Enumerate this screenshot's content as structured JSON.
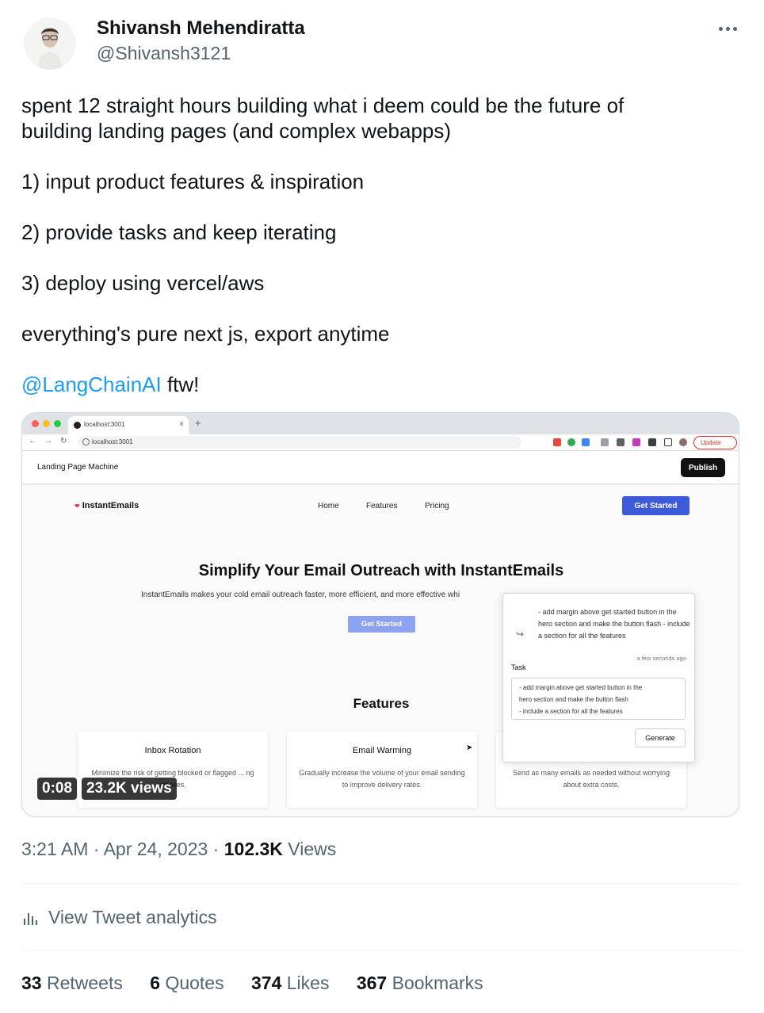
{
  "author": {
    "name": "Shivansh Mehendiratta",
    "handle": "@Shivansh3121"
  },
  "tweet": {
    "line1": "spent 12 straight hours building what i deem could be the future of",
    "line2": "building landing pages (and complex webapps)",
    "step1": "1) input product features & inspiration",
    "step2": "2) provide tasks and keep iterating",
    "step3": "3) deploy using vercel/aws",
    "closing": "everything's pure next js, export anytime",
    "mention": "@LangChainAI",
    "suffix": " ftw!"
  },
  "media": {
    "browser": {
      "tab_title": "localhost:3001",
      "new_tab": "+",
      "url": "localhost:3001",
      "update_label": "Update"
    },
    "app": {
      "title": "Landing Page Machine",
      "publish_label": "Publish"
    },
    "site": {
      "brand": "InstantEmails",
      "nav": [
        "Home",
        "Features",
        "Pricing"
      ],
      "cta": "Get Started",
      "hero_title": "Simplify Your Email Outreach with InstantEmails",
      "hero_subtitle": "InstantEmails makes your cold email outreach faster, more efficient, and more effective whi",
      "hero_cta": "Get Started",
      "features_title": "Features",
      "features": [
        {
          "title": "Inbox Rotation",
          "desc": "Minimize the risk of getting blocked or flagged ... ng inboxes."
        },
        {
          "title": "Email Warming",
          "desc": "Gradually increase the volume of your email sending to improve delivery rates."
        },
        {
          "title": "",
          "desc": "Send as many emails as needed without worrying about extra costs."
        }
      ]
    },
    "task_panel": {
      "history": "- add margin above get started button in the hero section and make the button flash - include a section for all the features",
      "time": "a few seconds ago",
      "label": "Task",
      "task_line1": "- add margin above get started button in the",
      "task_line2": "hero section and make the button flash",
      "task_line3": "- include a section for all the features",
      "generate_label": "Generate"
    },
    "video": {
      "duration": "0:08",
      "views": "23.2K views"
    }
  },
  "meta": {
    "time": "3:21 AM",
    "date": "Apr 24, 2023",
    "views_count": "102.3K",
    "views_label": "Views"
  },
  "analytics_label": "View Tweet analytics",
  "stats": {
    "retweets_count": "33",
    "retweets_label": "Retweets",
    "quotes_count": "6",
    "quotes_label": "Quotes",
    "likes_count": "374",
    "likes_label": "Likes",
    "bookmarks_count": "367",
    "bookmarks_label": "Bookmarks"
  },
  "colors": {
    "link": "#1d9bf0",
    "secondary_text": "#536471",
    "primary_text": "#0f1419",
    "site_accent": "#3b5bdb"
  },
  "icons": [
    "more-icon",
    "analytics-bar-icon",
    "redo-icon",
    "heart-icon",
    "mouse-cursor-icon"
  ]
}
